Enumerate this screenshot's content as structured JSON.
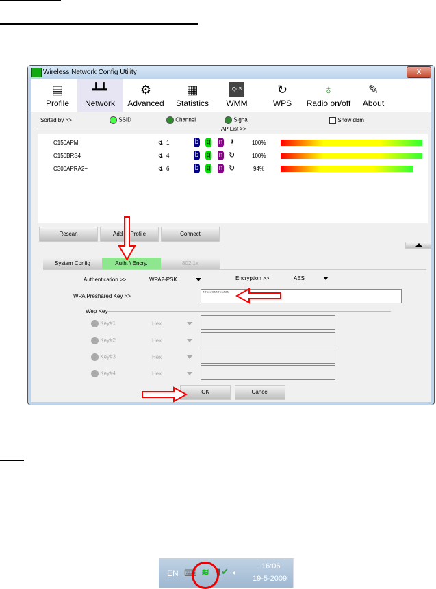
{
  "window": {
    "title": "Wireless Network Config Utility",
    "close": "X"
  },
  "toolbar": [
    {
      "label": "Profile",
      "icon": "profile-icon"
    },
    {
      "label": "Network",
      "icon": "router-icon"
    },
    {
      "label": "Advanced",
      "icon": "gear-icon"
    },
    {
      "label": "Statistics",
      "icon": "statistics-icon"
    },
    {
      "label": "WMM",
      "icon": "qos-icon"
    },
    {
      "label": "WPS",
      "icon": "wps-icon"
    },
    {
      "label": "Radio on/off",
      "icon": "radio-icon"
    },
    {
      "label": "About",
      "icon": "about-icon"
    }
  ],
  "sort": {
    "label": "Sorted by >>",
    "ssid": "SSID",
    "channel": "Channel",
    "signal": "Signal",
    "show_dbm": "Show dBm",
    "ap_list": "AP List >>"
  },
  "aps": [
    {
      "ssid": "C150APM",
      "channel": "1",
      "b": "b",
      "g": "g",
      "n": "n",
      "signal": "100%",
      "strength": 100,
      "security": "key"
    },
    {
      "ssid": "C150BRS4",
      "channel": "4",
      "b": "b",
      "g": "g",
      "n": "n",
      "signal": "100%",
      "strength": 100,
      "security": "wps"
    },
    {
      "ssid": "C300APRA2+",
      "channel": "6",
      "b": "b",
      "g": "g",
      "n": "n",
      "signal": "94%",
      "strength": 94,
      "security": "wps"
    }
  ],
  "buttons": {
    "rescan": "Rescan",
    "add_profile": "Add to Profile",
    "connect": "Connect",
    "ok": "OK",
    "cancel": "Cancel"
  },
  "tabs": [
    "System Config",
    "Auth. \\ Encry.",
    "802.1x"
  ],
  "auth": {
    "auth_label": "Authentication >>",
    "auth_value": "WPA2-PSK",
    "enc_label": "Encryption >>",
    "enc_value": "AES",
    "psk_label": "WPA Preshared Key >>",
    "psk_value": "**************",
    "wep_label": "Wep Key"
  },
  "wep_keys": [
    {
      "label": "Key#1",
      "format": "Hex"
    },
    {
      "label": "Key#2",
      "format": "Hex"
    },
    {
      "label": "Key#3",
      "format": "Hex"
    },
    {
      "label": "Key#4",
      "format": "Hex"
    }
  ],
  "taskbar": {
    "lang": "EN",
    "time": "16:06",
    "date": "19-5-2009"
  },
  "colors": {
    "active_tab": "#8ee68e",
    "arrow": "#ff0000"
  }
}
